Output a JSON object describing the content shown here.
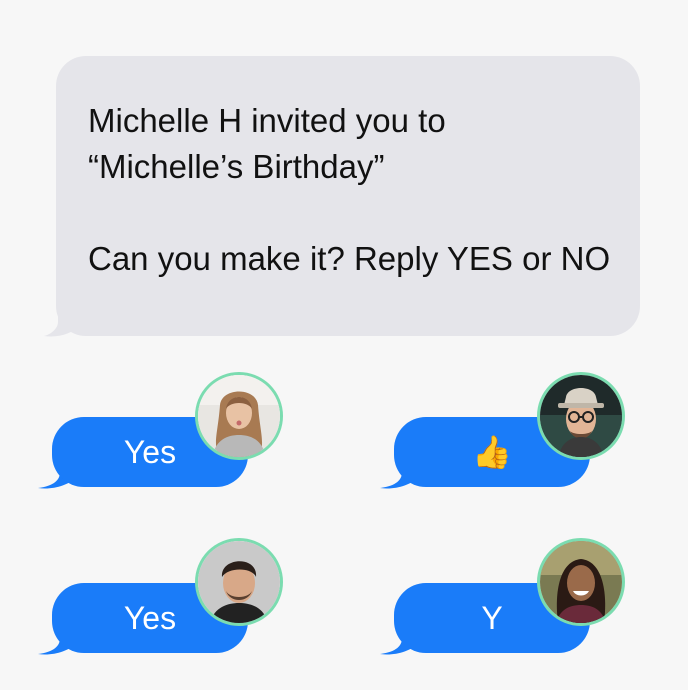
{
  "invite": {
    "line1": "Michelle H invited you to",
    "line2": "“Michelle’s Birthday”",
    "line3": "Can you make it? Reply YES or NO"
  },
  "replies": [
    {
      "text": "Yes",
      "avatar": "woman-blowing-kiss-avatar"
    },
    {
      "text": "👍",
      "avatar": "man-with-hat-glasses-avatar"
    },
    {
      "text": "Yes",
      "avatar": "man-dark-hair-avatar"
    },
    {
      "text": "Y",
      "avatar": "woman-smiling-avatar"
    }
  ],
  "colors": {
    "incoming_bubble": "#e5e5ea",
    "outgoing_bubble": "#1a7cf9",
    "avatar_ring": "#7bdcb0"
  }
}
